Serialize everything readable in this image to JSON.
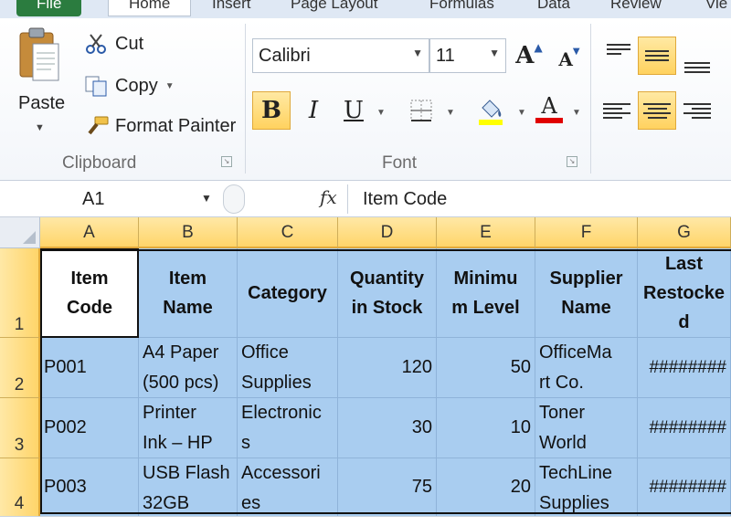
{
  "tabs": [
    "File",
    "Home",
    "Insert",
    "Page Layout",
    "Formulas",
    "Data",
    "Review",
    "Vie"
  ],
  "clipboard": {
    "group_label": "Clipboard",
    "paste_label": "Paste",
    "cut_label": "Cut",
    "copy_label": "Copy",
    "format_painter_label": "Format Painter"
  },
  "font": {
    "group_label": "Font",
    "font_name": "Calibri",
    "font_size": "11",
    "bold": "B",
    "italic": "I",
    "underline": "U",
    "grow": "A",
    "shrink": "A",
    "font_color_letter": "A",
    "fill_color": "#ffff00",
    "font_color": "#e00000"
  },
  "formula_bar": {
    "name_box": "A1",
    "fx": "fx",
    "value": "Item Code"
  },
  "columns": [
    "A",
    "B",
    "C",
    "D",
    "E",
    "F",
    "G"
  ],
  "rows": [
    "1",
    "2",
    "3",
    "4"
  ],
  "header_row": [
    [
      "Item",
      "Code"
    ],
    [
      "Item",
      "Name"
    ],
    [
      "Category"
    ],
    [
      "Quantity",
      "in Stock"
    ],
    [
      "Minimu",
      "m Level"
    ],
    [
      "Supplier",
      "Name"
    ],
    [
      "Last",
      "Restocke",
      "d"
    ]
  ],
  "data_rows": [
    {
      "code": "P001",
      "name": [
        "A4 Paper",
        "(500 pcs)"
      ],
      "category": [
        "Office",
        "Supplies"
      ],
      "qty": "120",
      "min": "50",
      "supplier": [
        "OfficeMa",
        "rt Co."
      ],
      "restocked": "########"
    },
    {
      "code": "P002",
      "name": [
        "Printer",
        "Ink – HP"
      ],
      "category": [
        "Electronic",
        "s"
      ],
      "qty": "30",
      "min": "10",
      "supplier": [
        "Toner",
        "World"
      ],
      "restocked": "########"
    },
    {
      "code": "P003",
      "name": [
        "USB Flash",
        "32GB"
      ],
      "category": [
        "Accessori",
        "es"
      ],
      "qty": "75",
      "min": "20",
      "supplier": [
        "TechLine",
        "Supplies"
      ],
      "restocked": "########"
    }
  ]
}
